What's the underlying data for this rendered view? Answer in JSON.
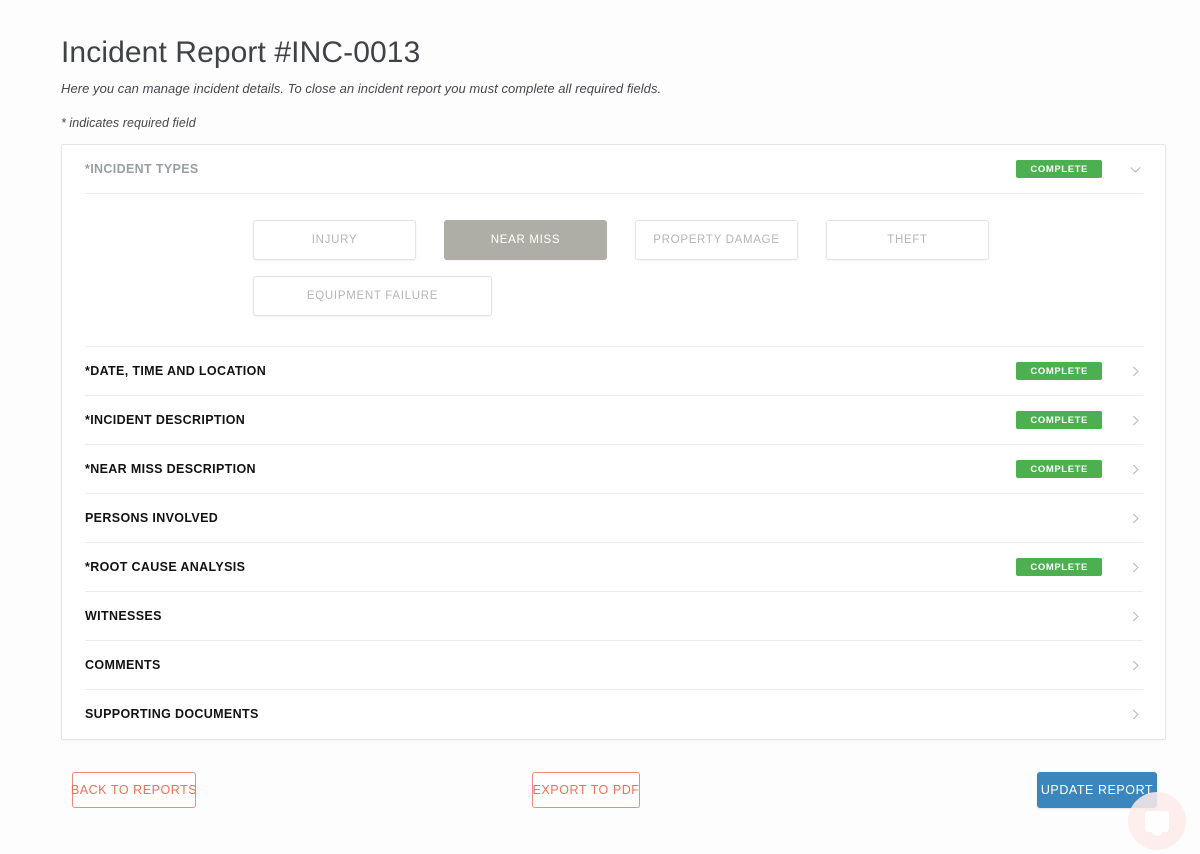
{
  "header": {
    "title": "Incident Report #INC-0013",
    "subtitle": "Here you can manage incident details. To close an incident report you must complete all required fields.",
    "required_note": "* indicates required field"
  },
  "colors": {
    "complete_badge": "#4caf50",
    "primary_button": "#3b87bd",
    "outline_button": "#f26f5c",
    "selected_type": "#aeaea6",
    "card_border": "#e6e6e6"
  },
  "sections": [
    {
      "label": "*INCIDENT TYPES",
      "status": "COMPLETE",
      "has_status": true,
      "open": true,
      "chevron": "chevron-down-icon"
    },
    {
      "label": "*DATE, TIME AND LOCATION",
      "status": "COMPLETE",
      "has_status": true,
      "open": false,
      "chevron": "chevron-right-icon"
    },
    {
      "label": "*INCIDENT DESCRIPTION",
      "status": "COMPLETE",
      "has_status": true,
      "open": false,
      "chevron": "chevron-right-icon"
    },
    {
      "label": "*NEAR MISS DESCRIPTION",
      "status": "COMPLETE",
      "has_status": true,
      "open": false,
      "chevron": "chevron-right-icon"
    },
    {
      "label": "PERSONS INVOLVED",
      "status": "",
      "has_status": false,
      "open": false,
      "chevron": "chevron-right-icon"
    },
    {
      "label": "*ROOT CAUSE ANALYSIS",
      "status": "COMPLETE",
      "has_status": true,
      "open": false,
      "chevron": "chevron-right-icon"
    },
    {
      "label": "WITNESSES",
      "status": "",
      "has_status": false,
      "open": false,
      "chevron": "chevron-right-icon"
    },
    {
      "label": "COMMENTS",
      "status": "",
      "has_status": false,
      "open": false,
      "chevron": "chevron-right-icon"
    },
    {
      "label": "SUPPORTING DOCUMENTS",
      "status": "",
      "has_status": false,
      "open": false,
      "chevron": "chevron-right-icon"
    }
  ],
  "incident_types": [
    {
      "label": "INJURY",
      "selected": false,
      "wide": false
    },
    {
      "label": "NEAR MISS",
      "selected": true,
      "wide": false
    },
    {
      "label": "PROPERTY DAMAGE",
      "selected": false,
      "wide": false
    },
    {
      "label": "THEFT",
      "selected": false,
      "wide": false
    },
    {
      "label": "EQUIPMENT FAILURE",
      "selected": false,
      "wide": true
    }
  ],
  "actions": {
    "back": "BACK TO REPORTS",
    "export": "EXPORT TO PDF",
    "update": "UPDATE REPORT"
  },
  "chat_widget": {
    "icon": "chat-bubble-icon"
  }
}
